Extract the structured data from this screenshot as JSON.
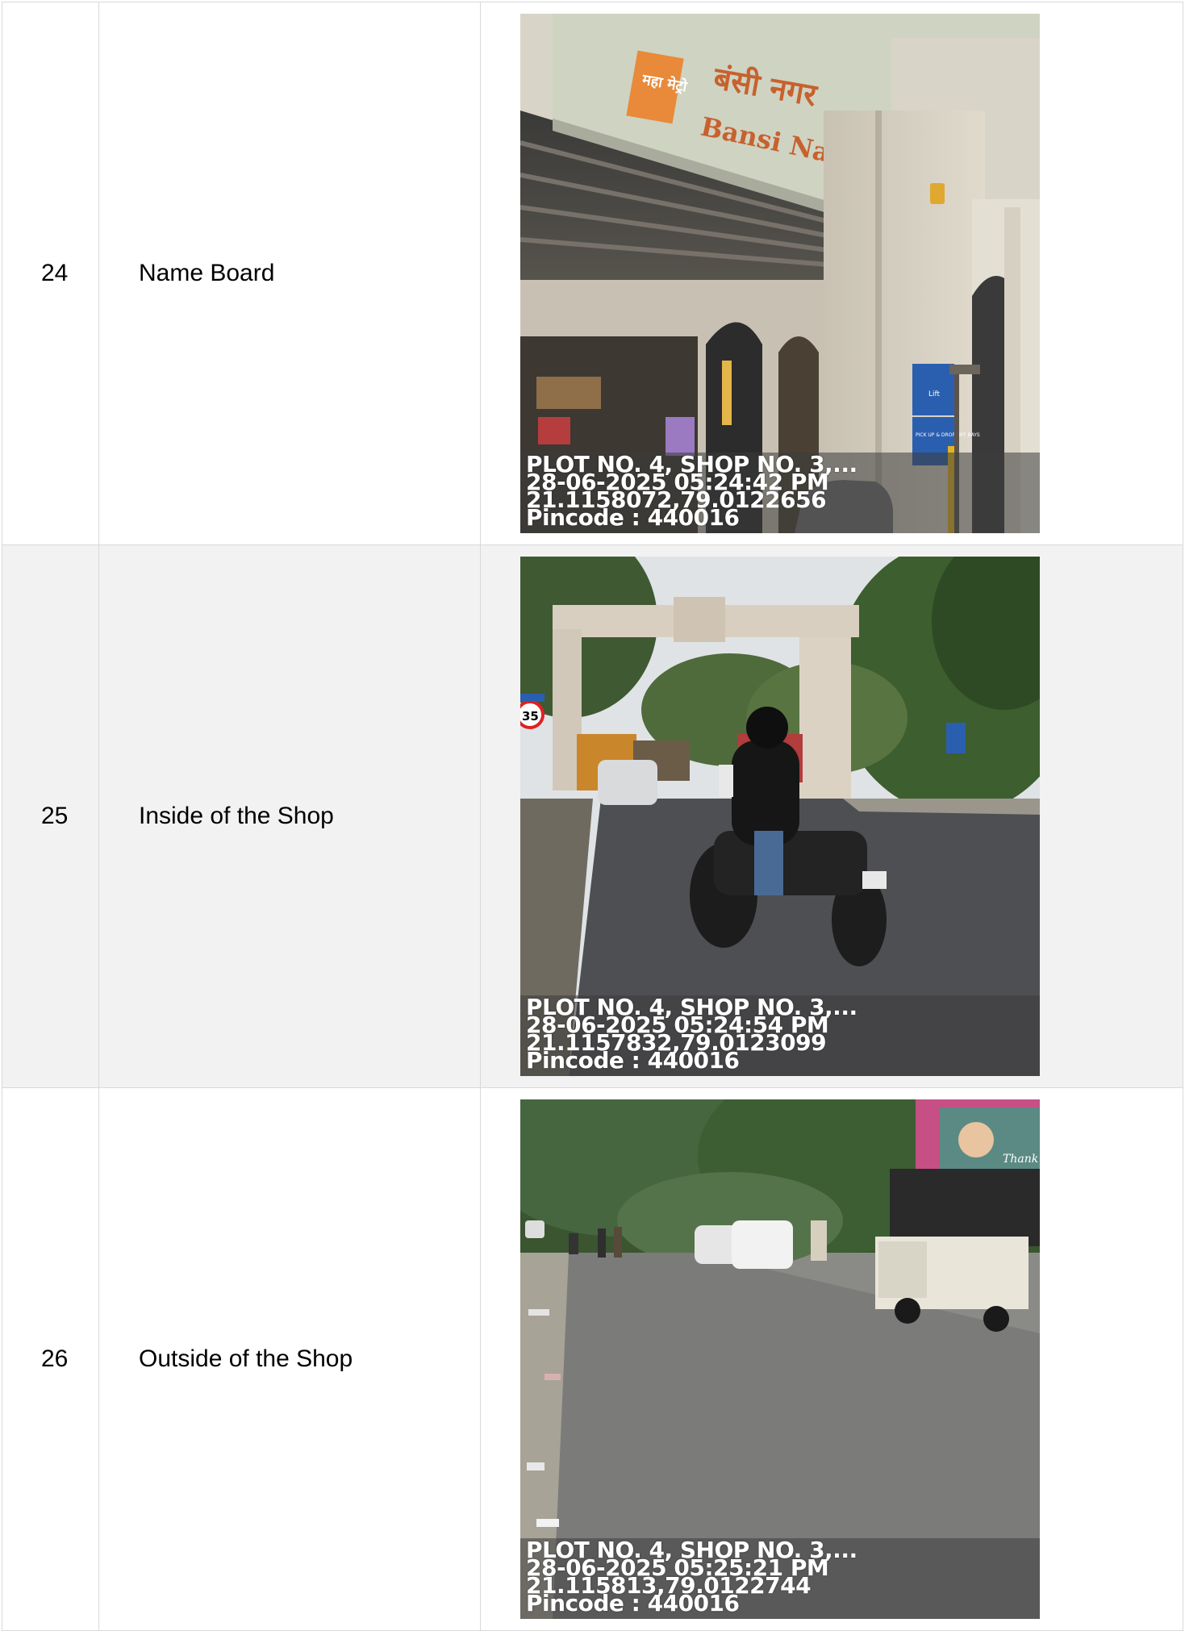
{
  "rows": [
    {
      "sr": "24",
      "label": "Name Board",
      "stamp": {
        "address": "PLOT NO. 4, SHOP NO. 3,...",
        "datetime": "28-06-2025 05:24:42 PM",
        "coords": "21.1158072,79.0122656",
        "pincode": "Pincode : 440016"
      },
      "sign": {
        "marathi": "बंसी नगर",
        "english": "Bansi Nagar",
        "logo": "महा मेट्रो",
        "lift": "Lift",
        "pickup": "PICK UP & DROP OFF BAYS"
      }
    },
    {
      "sr": "25",
      "label": "Inside of the Shop",
      "stamp": {
        "address": "PLOT NO. 4, SHOP NO. 3,...",
        "datetime": "28-06-2025 05:24:54 PM",
        "coords": "21.1157832,79.0123099",
        "pincode": "Pincode : 440016"
      },
      "sign": {
        "speed": "35"
      }
    },
    {
      "sr": "26",
      "label": "Outside of the Shop",
      "stamp": {
        "address": "PLOT NO. 4, SHOP NO. 3,...",
        "datetime": "28-06-2025 05:25:21 PM",
        "coords": "21.115813,79.0122744",
        "pincode": "Pincode : 440016"
      },
      "sign": {
        "billboard": "Thank"
      }
    }
  ]
}
